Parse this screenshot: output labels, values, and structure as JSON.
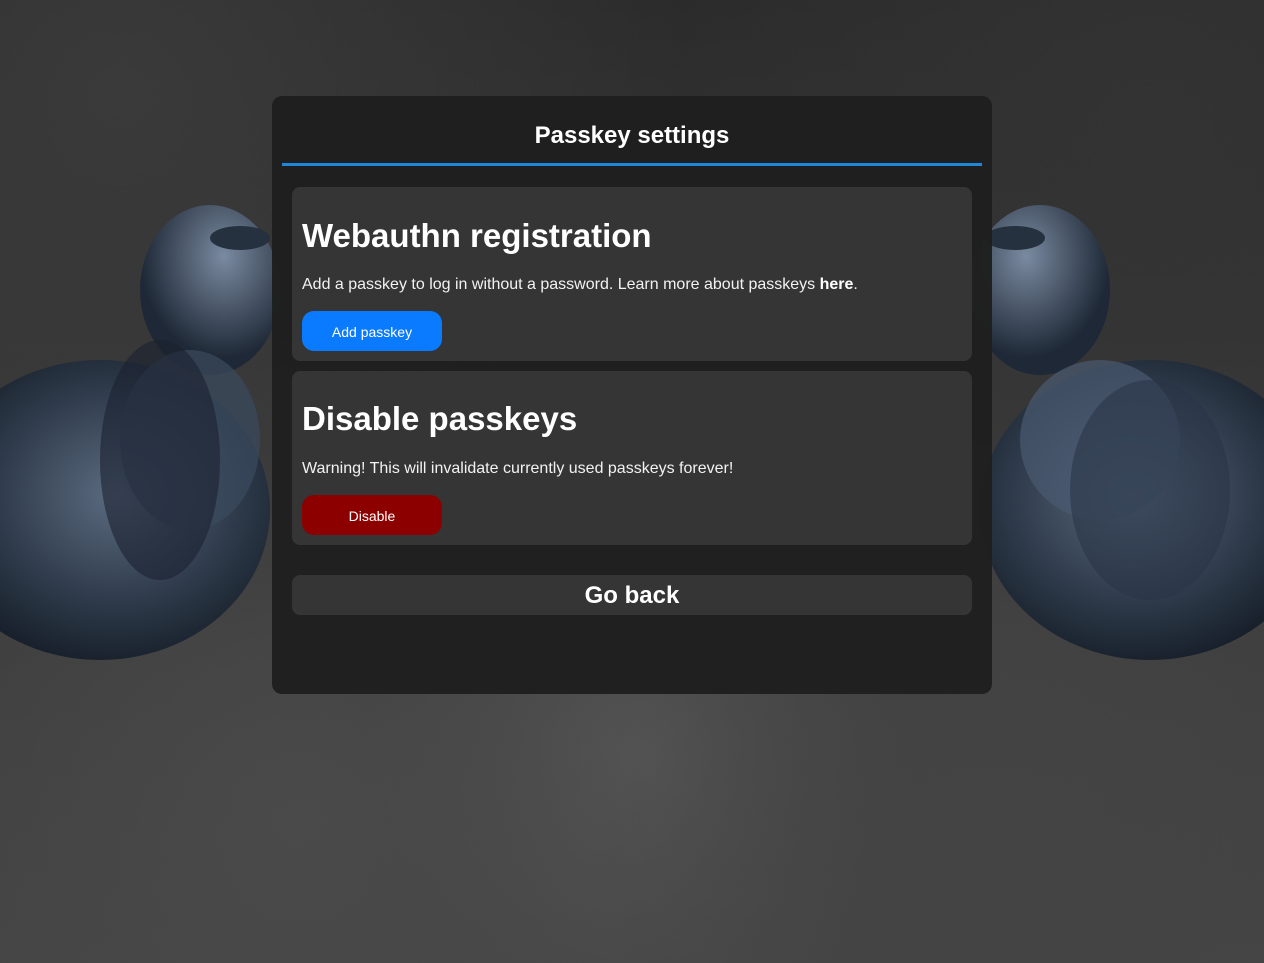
{
  "page": {
    "title": "Passkey settings"
  },
  "webauthn": {
    "heading": "Webauthn registration",
    "description_before_link": "Add a passkey to log in without a password. Learn more about passkeys ",
    "link_text": "here",
    "description_after_link": ".",
    "button_label": "Add passkey",
    "button_color": "#0a7bff"
  },
  "disable": {
    "heading": "Disable passkeys",
    "warning": "Warning! This will invalidate currently used passkeys forever!",
    "button_label": "Disable",
    "button_color": "#8c0000"
  },
  "nav": {
    "go_back_label": "Go back"
  },
  "theme": {
    "accent": "#1f88d8",
    "panel_bg": "#1f1f1f",
    "card_bg": "#353535"
  },
  "background": {
    "image": "two-pigeons-on-stone"
  }
}
